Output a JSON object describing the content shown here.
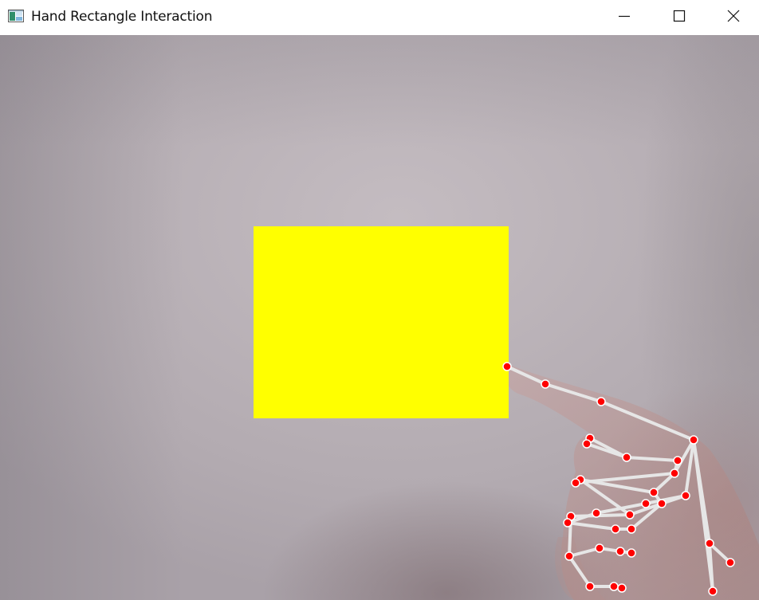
{
  "window": {
    "title": "Hand Rectangle Interaction",
    "icon": "app-window-icon",
    "controls": {
      "minimize_icon": "minimize-icon",
      "maximize_icon": "maximize-icon",
      "close_icon": "close-icon"
    }
  },
  "scene": {
    "rectangle_color": "#ffff00",
    "landmark_color": "#ff0000",
    "connection_color": "#e6e6e6"
  }
}
